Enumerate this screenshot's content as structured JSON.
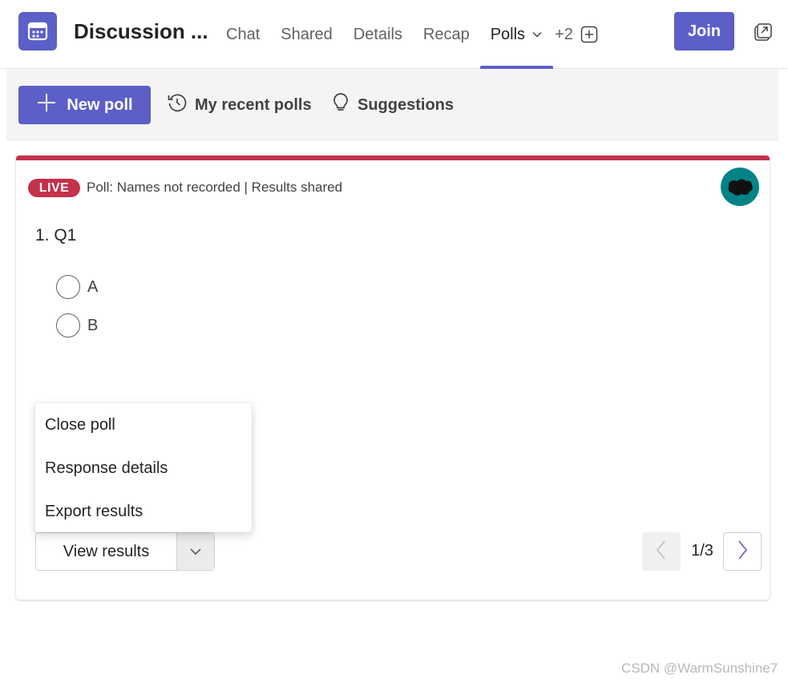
{
  "header": {
    "title": "Discussion ...",
    "tabs": [
      {
        "label": "Chat"
      },
      {
        "label": "Shared"
      },
      {
        "label": "Details"
      },
      {
        "label": "Recap"
      },
      {
        "label": "Polls"
      }
    ],
    "active_tab": "Polls",
    "more_tabs": "+2",
    "join_label": "Join",
    "accent_color": "#5b5fc7"
  },
  "toolbar": {
    "new_poll_label": "New poll",
    "recent_polls_label": "My recent polls",
    "suggestions_label": "Suggestions"
  },
  "poll": {
    "status_badge": "LIVE",
    "status_color": "#c4314b",
    "meta": "Poll: Names not recorded | Results shared",
    "question": "1.  Q1",
    "options": [
      {
        "label": "A"
      },
      {
        "label": "B"
      }
    ],
    "menu_items": [
      {
        "label": "Close poll"
      },
      {
        "label": "Response details"
      },
      {
        "label": "Export results"
      }
    ],
    "primary_action": "View results",
    "pager": "1/3"
  },
  "watermark": "CSDN @WarmSunshine7",
  "icons": {
    "app": "calendar-icon",
    "tab_dropdown": "chevron-down-icon",
    "add_tab": "add-square-icon",
    "popout": "popout-icon",
    "new_poll": "plus-icon",
    "recent": "history-icon",
    "suggestions": "lightbulb-icon"
  }
}
